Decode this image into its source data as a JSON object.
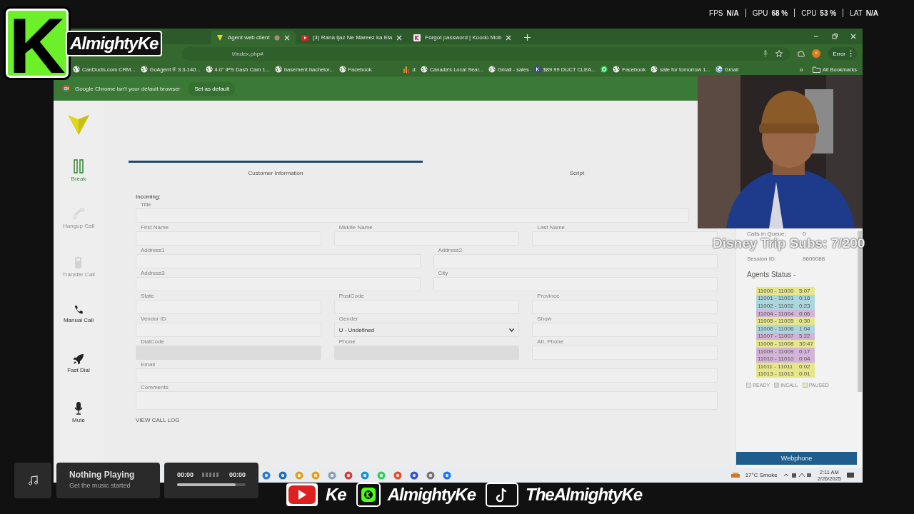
{
  "overlay": {
    "logo_letter": "K",
    "logo_text": "AlmightyKe",
    "stats": [
      {
        "label": "FPS",
        "value": "N/A"
      },
      {
        "label": "GPU",
        "value": "68 %"
      },
      {
        "label": "CPU",
        "value": "53 %"
      },
      {
        "label": "LAT",
        "value": "N/A"
      }
    ],
    "goal_text": "Disney Trip Subs: 7/200",
    "music": {
      "title": "Nothing Playing",
      "subtitle": "Get the music started",
      "elapsed": "00:00",
      "total": "00:00",
      "level": 0.85
    },
    "socials": [
      {
        "kind": "youtube",
        "handle": "Ke"
      },
      {
        "kind": "kick",
        "handle": "AlmightyKe"
      },
      {
        "kind": "tiktok",
        "handle": "TheAlmightyKe"
      }
    ]
  },
  "browser": {
    "tabs": [
      {
        "title": "Agent web client",
        "kind": "vee",
        "selected": true
      },
      {
        "title": "(3) Rana Ijaz Ne Mareez ka Ela",
        "kind": "video",
        "selected": false
      },
      {
        "title": "Forgot password | Koodo Mob",
        "kind": "koodo",
        "selected": false
      }
    ],
    "url": "t/index.php#",
    "profile_button": "Error",
    "bookmarks": [
      {
        "kind": "globe",
        "label": "CanDucts.com CRM..."
      },
      {
        "kind": "globe",
        "label": "GoAgent ® 3.3-140..."
      },
      {
        "kind": "globe",
        "label": "4.0\" IPS Dash Cam 1..."
      },
      {
        "kind": "globe",
        "label": "basement bachelor..."
      },
      {
        "kind": "globe",
        "label": "Facebook"
      },
      {
        "kind": "chart",
        "label": "d"
      },
      {
        "kind": "globe",
        "label": "Canada's Local Sear..."
      },
      {
        "kind": "globe",
        "label": "Gmail - sales"
      },
      {
        "kind": "letter",
        "label": "$89.99 DUCT CLEA..."
      },
      {
        "kind": "whatsapp"
      },
      {
        "kind": "globe",
        "label": "Facebook"
      },
      {
        "kind": "globe",
        "label": "sale for tomorrow 1..."
      },
      {
        "kind": "google",
        "label": "Gmail"
      }
    ],
    "overflow_icon": "»",
    "all_bookmarks": "All Bookmarks",
    "infobar": {
      "message": "Google Chrome isn't your default browser",
      "button": "Set as default"
    }
  },
  "app": {
    "sidebar": [
      {
        "kind": "pause",
        "label": "Break",
        "selected": true,
        "disabled": false
      },
      {
        "kind": "hangup",
        "label": "Hangup Call",
        "selected": false,
        "disabled": true
      },
      {
        "kind": "transfer",
        "label": "Transfer Call",
        "selected": false,
        "disabled": true
      },
      {
        "kind": "phone",
        "label": "Manual Call",
        "selected": false,
        "disabled": false
      },
      {
        "kind": "rocket",
        "label": "Fast Dial",
        "selected": false,
        "disabled": false
      },
      {
        "kind": "mic",
        "label": "Mute",
        "selected": false,
        "disabled": false
      }
    ],
    "tabs": [
      {
        "label": "Customer Information",
        "selected": true
      },
      {
        "label": "Script",
        "selected": false
      }
    ],
    "incoming_label": "Incoming:",
    "form_rows": [
      [
        {
          "label": "Title",
          "kind": "text",
          "disabled": false
        }
      ],
      [
        {
          "label": "First Name",
          "kind": "text",
          "disabled": false
        },
        {
          "label": "Middle Name",
          "kind": "text",
          "disabled": false
        },
        {
          "label": "Last Name",
          "kind": "text",
          "disabled": false
        }
      ],
      [
        {
          "label": "Address1",
          "kind": "text",
          "disabled": false
        },
        {
          "label": "Address2",
          "kind": "text",
          "disabled": false
        }
      ],
      [
        {
          "label": "Address3",
          "kind": "text",
          "disabled": false
        },
        {
          "label": "City",
          "kind": "text",
          "disabled": false
        }
      ],
      [
        {
          "label": "State",
          "kind": "text",
          "disabled": false
        },
        {
          "label": "PostCode",
          "kind": "text",
          "disabled": false
        },
        {
          "label": "Province",
          "kind": "text",
          "disabled": false
        }
      ],
      [
        {
          "label": "Vendor ID",
          "kind": "text",
          "disabled": false
        },
        {
          "label": "Gender",
          "kind": "select",
          "value": "U - Undefined",
          "disabled": false
        },
        {
          "label": "Show",
          "kind": "text",
          "disabled": false
        }
      ],
      [
        {
          "label": "DialCode",
          "kind": "text",
          "disabled": true
        },
        {
          "label": "Phone",
          "kind": "text",
          "disabled": true
        },
        {
          "label": "Alt. Phone",
          "kind": "text",
          "disabled": false
        }
      ],
      [
        {
          "label": "Email",
          "kind": "text",
          "disabled": false
        }
      ],
      [
        {
          "label": "Comments",
          "kind": "textarea",
          "disabled": false
        }
      ]
    ],
    "call_log_link": "VIEW CALL LOG",
    "panel": {
      "info": [
        {
          "label": "Calls in Queue:",
          "value": "0"
        },
        {
          "label": "Session ID:",
          "value": "8600088"
        }
      ],
      "agents_title": "Agents Status -",
      "agents": [
        {
          "id": "11000 - 11000",
          "time": "5:07",
          "color": "#e6e68a"
        },
        {
          "id": "11001 - 11001",
          "time": "0:16",
          "color": "#aad6de"
        },
        {
          "id": "11002 - 11002",
          "time": "0:23",
          "color": "#aad6de"
        },
        {
          "id": "11004 - 11004",
          "time": "0:06",
          "color": "#d4b4d8"
        },
        {
          "id": "11005 - 11005",
          "time": "0:30",
          "color": "#e6e68a"
        },
        {
          "id": "11006 - 11006",
          "time": "1:04",
          "color": "#aad6de"
        },
        {
          "id": "11007 - 11007",
          "time": "5:22",
          "color": "#d4b4d8"
        },
        {
          "id": "11008 - 11008",
          "time": "30:47",
          "color": "#e6e68a"
        },
        {
          "id": "11009 - 11009",
          "time": "0:17",
          "color": "#d4b4d8"
        },
        {
          "id": "11010 - 11010",
          "time": "0:04",
          "color": "#d4b4d8"
        },
        {
          "id": "11011 - 11011",
          "time": "0:02",
          "color": "#e6e68a"
        },
        {
          "id": "11013 - 11013",
          "time": "0:01",
          "color": "#e6e68a"
        }
      ],
      "legend": [
        {
          "label": "READY",
          "color": "#d8e2e6"
        },
        {
          "label": "INCALL",
          "color": "#dcd2de"
        },
        {
          "label": "PAUSED",
          "color": "#e8e8c0"
        }
      ],
      "webphone_button": "Webphone"
    }
  },
  "taskbar": {
    "weather": "17°C Smoke",
    "time": "2:11 AM",
    "date": "2/26/2025"
  }
}
